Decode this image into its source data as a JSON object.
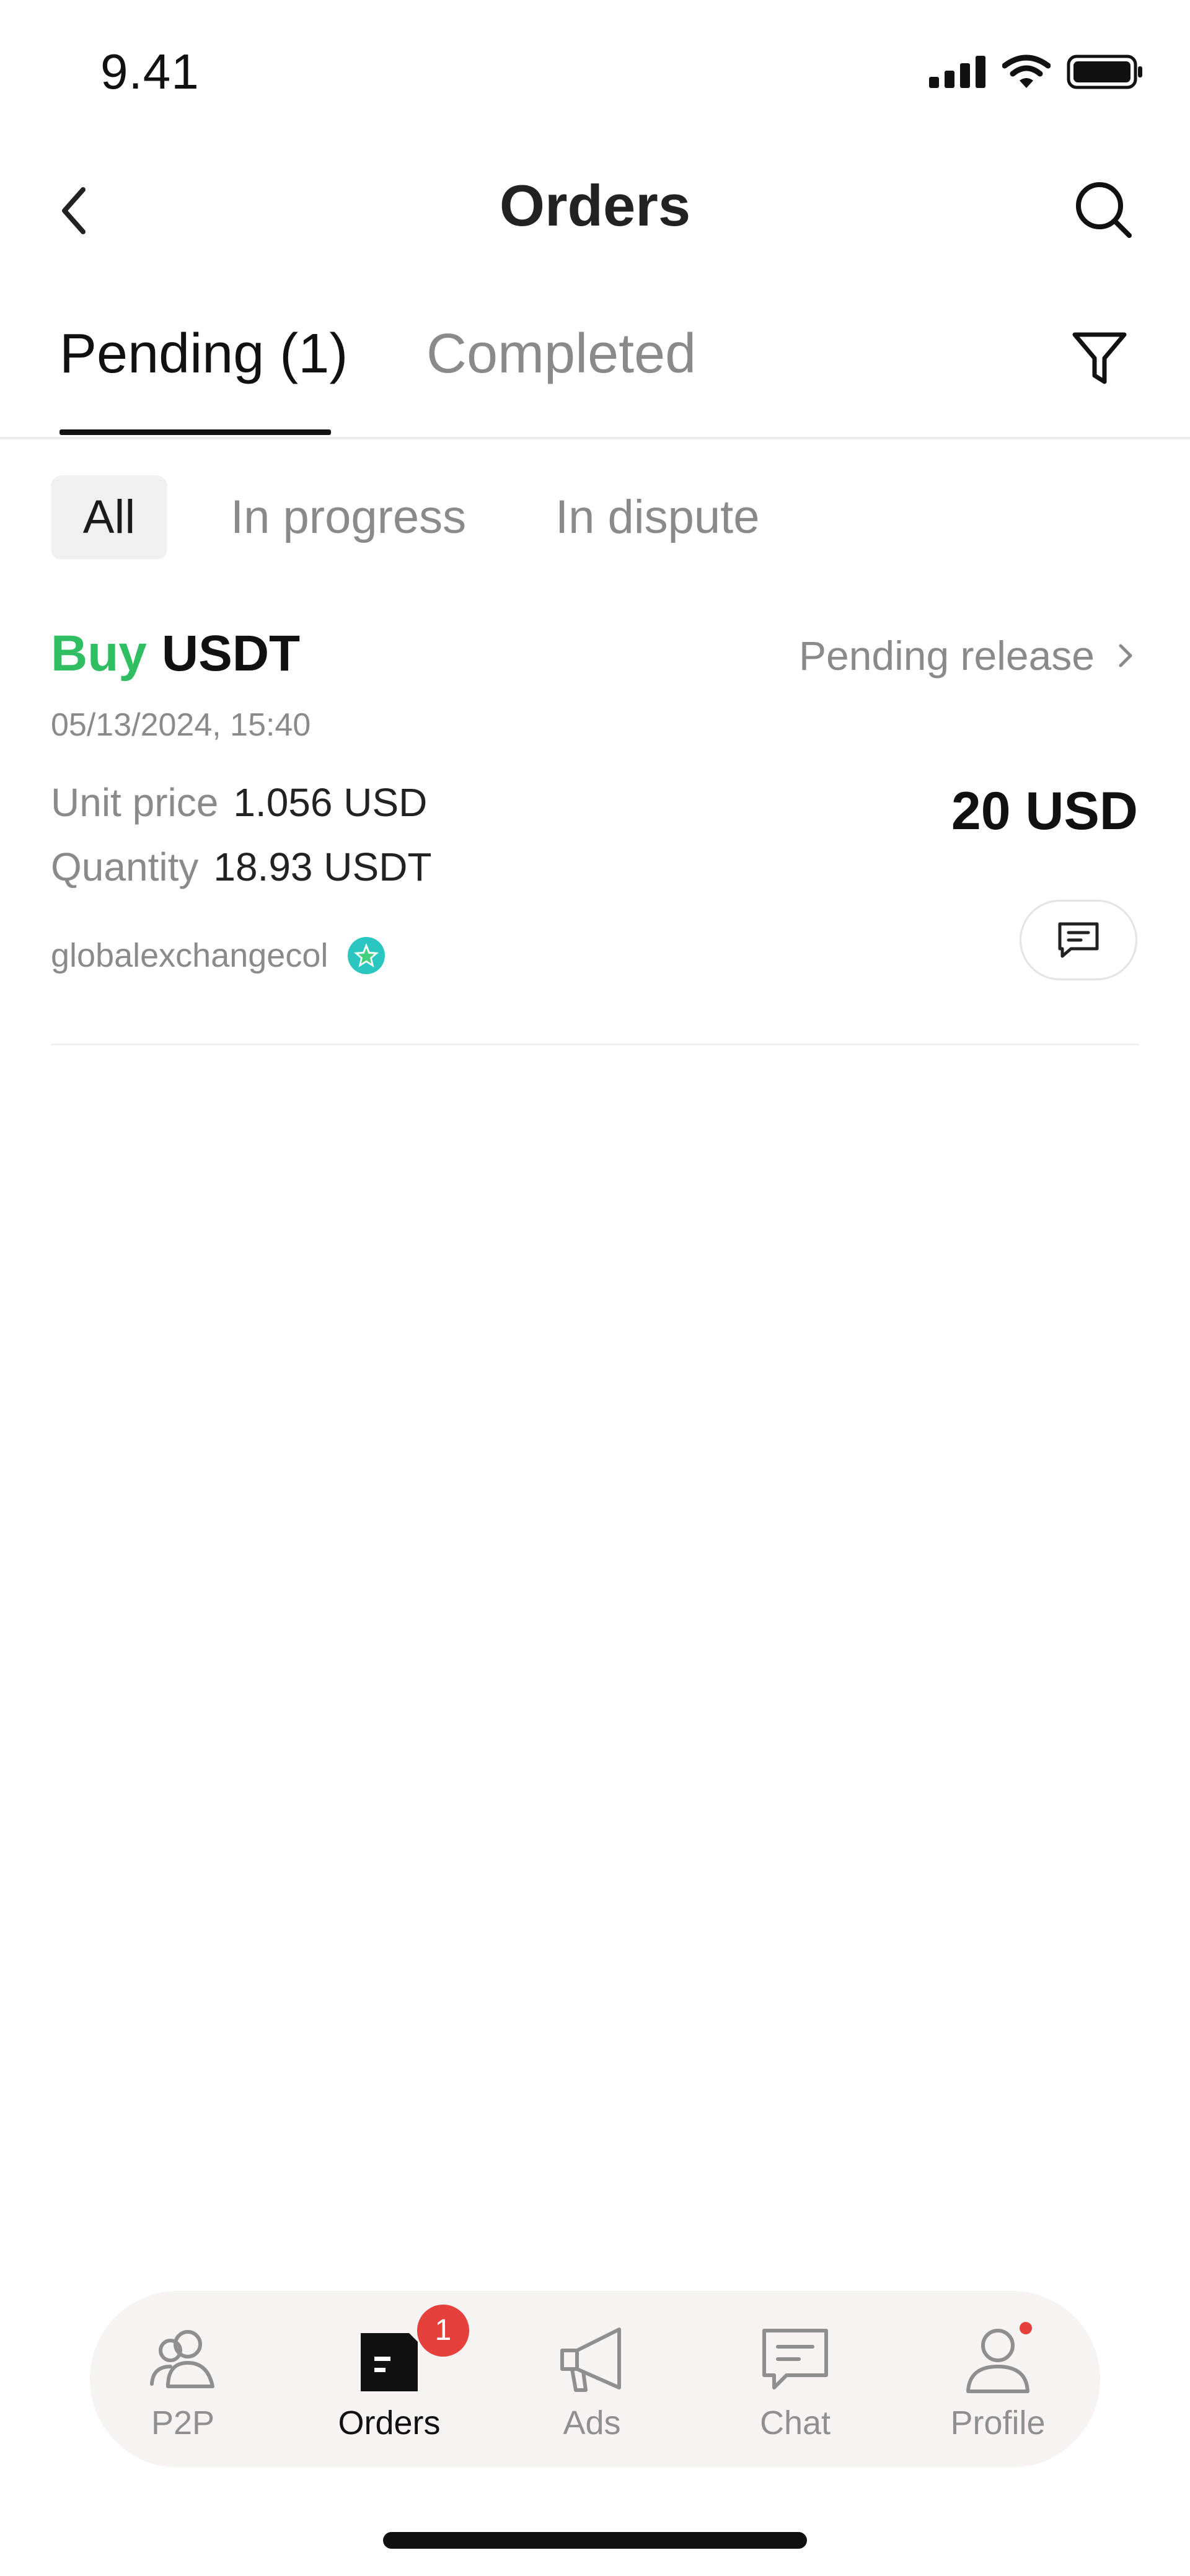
{
  "status_bar": {
    "time": "9.41"
  },
  "header": {
    "title": "Orders",
    "back_icon": "chevron-left-icon",
    "search_icon": "search-icon"
  },
  "tabs": {
    "pending": "Pending (1)",
    "completed": "Completed",
    "active": "pending",
    "filter_icon": "filter-icon"
  },
  "sub_filters": {
    "all": "All",
    "in_progress": "In progress",
    "in_dispute": "In dispute",
    "active": "all"
  },
  "order": {
    "side": "Buy",
    "asset": "USDT",
    "status": "Pending release",
    "date": "05/13/2024, 15:40",
    "unit_price_label": "Unit price",
    "unit_price_value": "1.056 USD",
    "quantity_label": "Quantity",
    "quantity_value": "18.93 USDT",
    "total": "20 USD",
    "merchant": "globalexchangecol",
    "merchant_badge_icon": "verified-star-icon",
    "chat_icon": "chat-bubble-icon"
  },
  "bottom_nav": {
    "items": [
      {
        "label": "P2P",
        "icon": "users-icon"
      },
      {
        "label": "Orders",
        "icon": "orders-icon",
        "badge": "1"
      },
      {
        "label": "Ads",
        "icon": "megaphone-icon"
      },
      {
        "label": "Chat",
        "icon": "chat-icon"
      },
      {
        "label": "Profile",
        "icon": "profile-icon"
      }
    ],
    "active_index": 1
  },
  "colors": {
    "buy": "#2fbf62",
    "badge": "#e5403c",
    "nav_background": "#f8f3f3",
    "muted_text": "#8a8a8a"
  }
}
